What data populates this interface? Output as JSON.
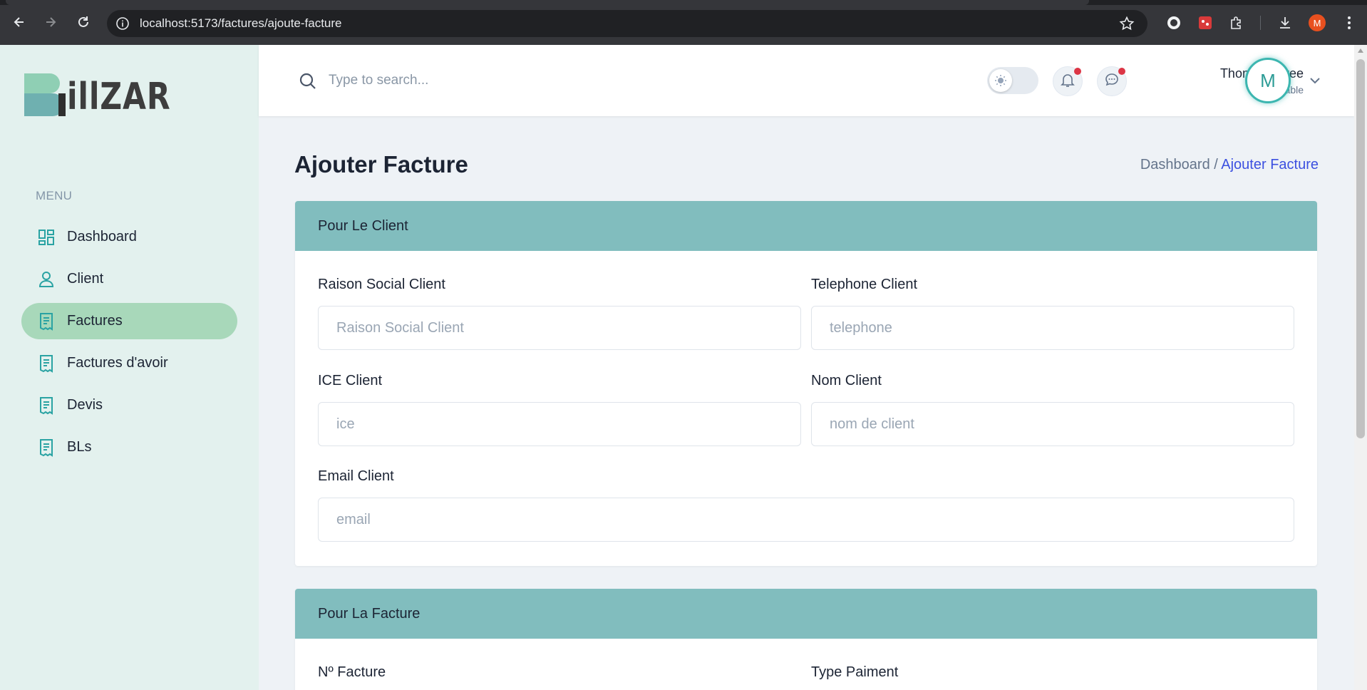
{
  "browser": {
    "url": "localhost:5173/factures/ajoute-facture",
    "profile_initial": "M"
  },
  "brand": {
    "logo_text": "illZAR"
  },
  "sidebar": {
    "menu_title": "MENU",
    "items": [
      {
        "label": "Dashboard",
        "icon": "dashboard-icon"
      },
      {
        "label": "Client",
        "icon": "user-icon"
      },
      {
        "label": "Factures",
        "icon": "receipt-icon",
        "active": true
      },
      {
        "label": "Factures d'avoir",
        "icon": "receipt-icon"
      },
      {
        "label": "Devis",
        "icon": "receipt-icon"
      },
      {
        "label": "BLs",
        "icon": "receipt-icon"
      }
    ]
  },
  "header": {
    "search_placeholder": "Type to search...",
    "user_name": "Thomas Anree",
    "user_role": "comptable",
    "avatar_initial": "M"
  },
  "page": {
    "title": "Ajouter Facture",
    "breadcrumb_root": "Dashboard /",
    "breadcrumb_current": "Ajouter Facture"
  },
  "client_section": {
    "title": "Pour Le Client",
    "fields": {
      "raison_social": {
        "label": "Raison Social Client",
        "placeholder": "Raison Social Client",
        "value": ""
      },
      "telephone": {
        "label": "Telephone Client",
        "placeholder": "telephone",
        "value": ""
      },
      "ice": {
        "label": "ICE Client",
        "placeholder": "ice",
        "value": ""
      },
      "nom": {
        "label": "Nom Client",
        "placeholder": "nom de client",
        "value": ""
      },
      "email": {
        "label": "Email Client",
        "placeholder": "email",
        "value": ""
      }
    }
  },
  "facture_section": {
    "title": "Pour La Facture",
    "fields": {
      "numero": {
        "label": "Nº Facture"
      },
      "type_paiment": {
        "label": "Type Paiment"
      }
    }
  },
  "colors": {
    "sidebar_bg": "#e3f1ee",
    "active_item": "#a8d8ba",
    "section_header": "#81bdbe",
    "accent": "#3c50e0",
    "icon_teal": "#2aa3a3"
  }
}
